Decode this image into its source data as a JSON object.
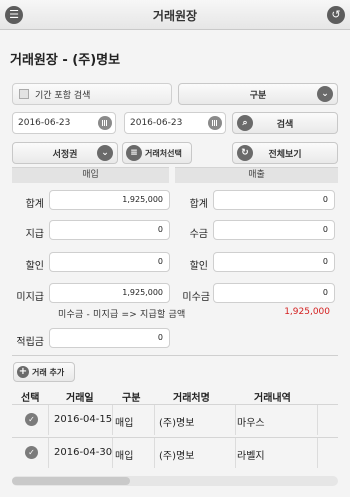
{
  "header": {
    "title": "거래원장"
  },
  "page_title": "거래원장 - (주)명보",
  "filters": {
    "include_period_label": "기간 포함 검색",
    "category_select": "구분",
    "date_from": "2016-06-23",
    "date_to": "2016-06-23",
    "search_label": "검색",
    "region_select": "서정권",
    "client_select_label": "거래처선택",
    "view_all_label": "전체보기"
  },
  "sections": {
    "purchase": "매입",
    "sales": "매출"
  },
  "purchase": {
    "total_label": "합계",
    "total": "1,925,000",
    "paid_label": "지급",
    "paid": "0",
    "discount_label": "할인",
    "discount": "0",
    "unpaid_label": "미지급",
    "unpaid": "1,925,000"
  },
  "sales": {
    "total_label": "합계",
    "total": "0",
    "received_label": "수금",
    "received": "0",
    "discount_label": "할인",
    "discount": "0",
    "unreceived_label": "미수금",
    "unreceived": "0"
  },
  "formula_text": "미수금 - 미지급 => 지급할 금액",
  "formula_value": "1,925,000",
  "reserve": {
    "label": "적립금",
    "value": "0"
  },
  "add_button": "거래 추가",
  "table": {
    "headers": [
      "선택",
      "거래일",
      "구분",
      "거래처명",
      "거래내역"
    ],
    "rows": [
      {
        "date": "2016-04-15",
        "type": "매입",
        "client": "(주)명보",
        "detail": "마우스"
      },
      {
        "date": "2016-04-30",
        "type": "매입",
        "client": "(주)명보",
        "detail": "라벨지"
      }
    ]
  },
  "colors": {
    "accent_red": "#d42020",
    "icon_gray": "#5d5d5d"
  }
}
